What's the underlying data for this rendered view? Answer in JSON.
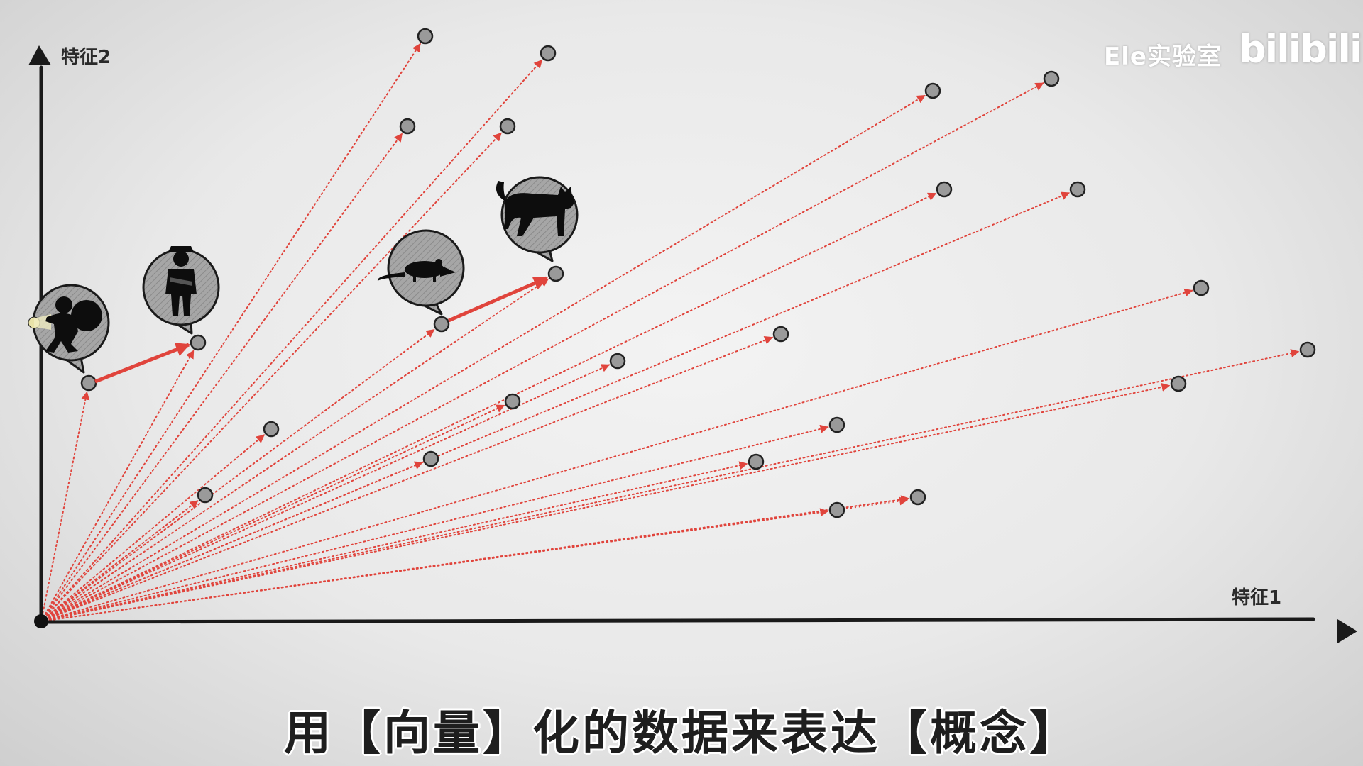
{
  "axes": {
    "y_label": "特征2",
    "x_label": "特征1"
  },
  "brand": {
    "channel_name": "Ele实验室",
    "logo_text": "bilibili"
  },
  "subtitle": "用【向量】化的数据来表达【概念】",
  "colors": {
    "vector_line": "#e0443c",
    "point_fill": "#9a9a9a",
    "axis": "#1a1a1a",
    "bubble_fill": "#a8a8a8"
  },
  "icons": {
    "thief": "thief-icon",
    "police": "police-icon",
    "mouse": "mouse-icon",
    "cat": "cat-icon"
  }
}
